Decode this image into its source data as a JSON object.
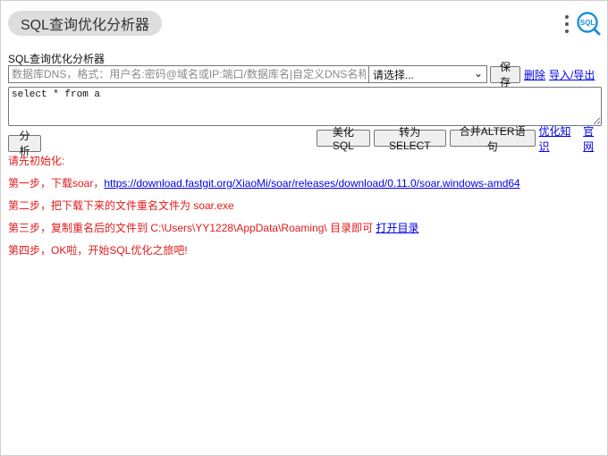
{
  "app_title": "SQL查询优化分析器",
  "logo_text": "SQL",
  "section_title": "SQL查询优化分析器",
  "connection": {
    "dsn_placeholder": "数据库DNS，格式：用户名:密码@域名或IP:端口/数据库名|自定义DNS名称",
    "select_value": "请选择...",
    "save_label": "保存",
    "delete_label": "删除",
    "import_export_label": "导入/导出"
  },
  "editor": {
    "sql_text": "select * from a"
  },
  "actions": {
    "analyze_label": "分析",
    "beautify_label": "美化SQL",
    "to_select_label": "转为SELECT",
    "merge_alter_label": "合并ALTER语句",
    "optimize_tips_label": "优化知识",
    "website_label": "官网"
  },
  "init_steps": {
    "intro": "请先初始化:",
    "step1_prefix": "第一步，下载soar，",
    "step1_link": "https://download.fastgit.org/XiaoMi/soar/releases/download/0.11.0/soar.windows-amd64",
    "step2": "第二步，把下载下来的文件重名文件为 soar.exe",
    "step3_prefix": "第三步，复制重名后的文件到 C:\\Users\\YY1228\\AppData\\Roaming\\ 目录即可 ",
    "step3_link": "打开目录",
    "step4": "第四步，OK啦，开始SQL优化之旅吧!"
  },
  "colors": {
    "accent": "#1a8fd6",
    "instruction_text": "#e31b1b",
    "link": "#0000ee",
    "pill_bg": "#dddddd"
  }
}
